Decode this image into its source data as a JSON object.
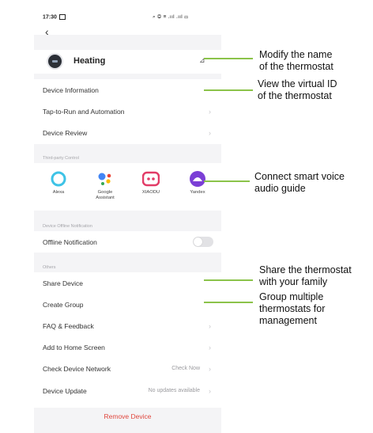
{
  "status_bar": {
    "time": "17:30",
    "icons_text": "⌕ ◎ ≡ .ııl .ııl ▭"
  },
  "device": {
    "name": "Heating"
  },
  "menu": {
    "device_information": "Device Information",
    "tap_to_run": "Tap-to-Run and Automation",
    "device_review": "Device Review"
  },
  "third_party": {
    "heading": "Third-party Control",
    "items": [
      {
        "label": "Alexa"
      },
      {
        "label": "Google\nAssistant"
      },
      {
        "label": "XIAODU"
      },
      {
        "label": "Yandex"
      }
    ]
  },
  "offline": {
    "heading": "Device Offline Notification",
    "label": "Offline Notification",
    "enabled": false
  },
  "others": {
    "heading": "Others",
    "share_device": "Share Device",
    "create_group": "Create Group",
    "faq": "FAQ & Feedback",
    "add_home": "Add to Home Screen",
    "check_network": "Check Device Network",
    "check_network_value": "Check Now",
    "device_update": "Device Update",
    "device_update_value": "No updates available"
  },
  "remove_device": "Remove Device",
  "callouts": {
    "modify_name": "Modify the name\nof the thermostat",
    "view_id": "View the virtual ID\nof the thermostat",
    "voice": "Connect smart voice\naudio guide",
    "share": "Share the thermostat\nwith your family",
    "group": "Group multiple\nthermostats for\nmanagement"
  },
  "colors": {
    "accent_line": "#8bc34a",
    "remove_text": "#e0473e"
  }
}
